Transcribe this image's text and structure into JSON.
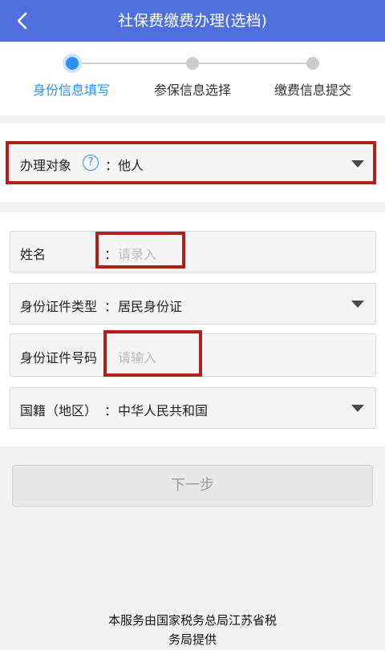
{
  "header": {
    "title": "社保费缴费办理(选档)",
    "back_icon": "chevron-left-icon"
  },
  "steps": [
    {
      "label": "身份信息填写",
      "active": true
    },
    {
      "label": "参保信息选择",
      "active": false
    },
    {
      "label": "缴费信息提交",
      "active": false
    }
  ],
  "handling": {
    "label": "办理对象",
    "help": "?",
    "colon": "：",
    "value": "他人"
  },
  "form": {
    "name": {
      "label": "姓名",
      "colon": "：",
      "placeholder": "请录入"
    },
    "id_type": {
      "label": "身份证件类型",
      "colon": "：",
      "value": "居民身份证"
    },
    "id_number": {
      "label": "身份证件号码",
      "placeholder": "请输入"
    },
    "nationality": {
      "label": "国籍（地区）",
      "colon": "：",
      "value": "中华人民共和国"
    }
  },
  "next_button": "下一步",
  "footer": {
    "line1": "本服务由国家税务总局江苏省税",
    "line2": "务局提供"
  },
  "colors": {
    "header_bg": "#4f6fdc",
    "accent": "#2f8ff2",
    "highlight_box": "#b3201b"
  }
}
